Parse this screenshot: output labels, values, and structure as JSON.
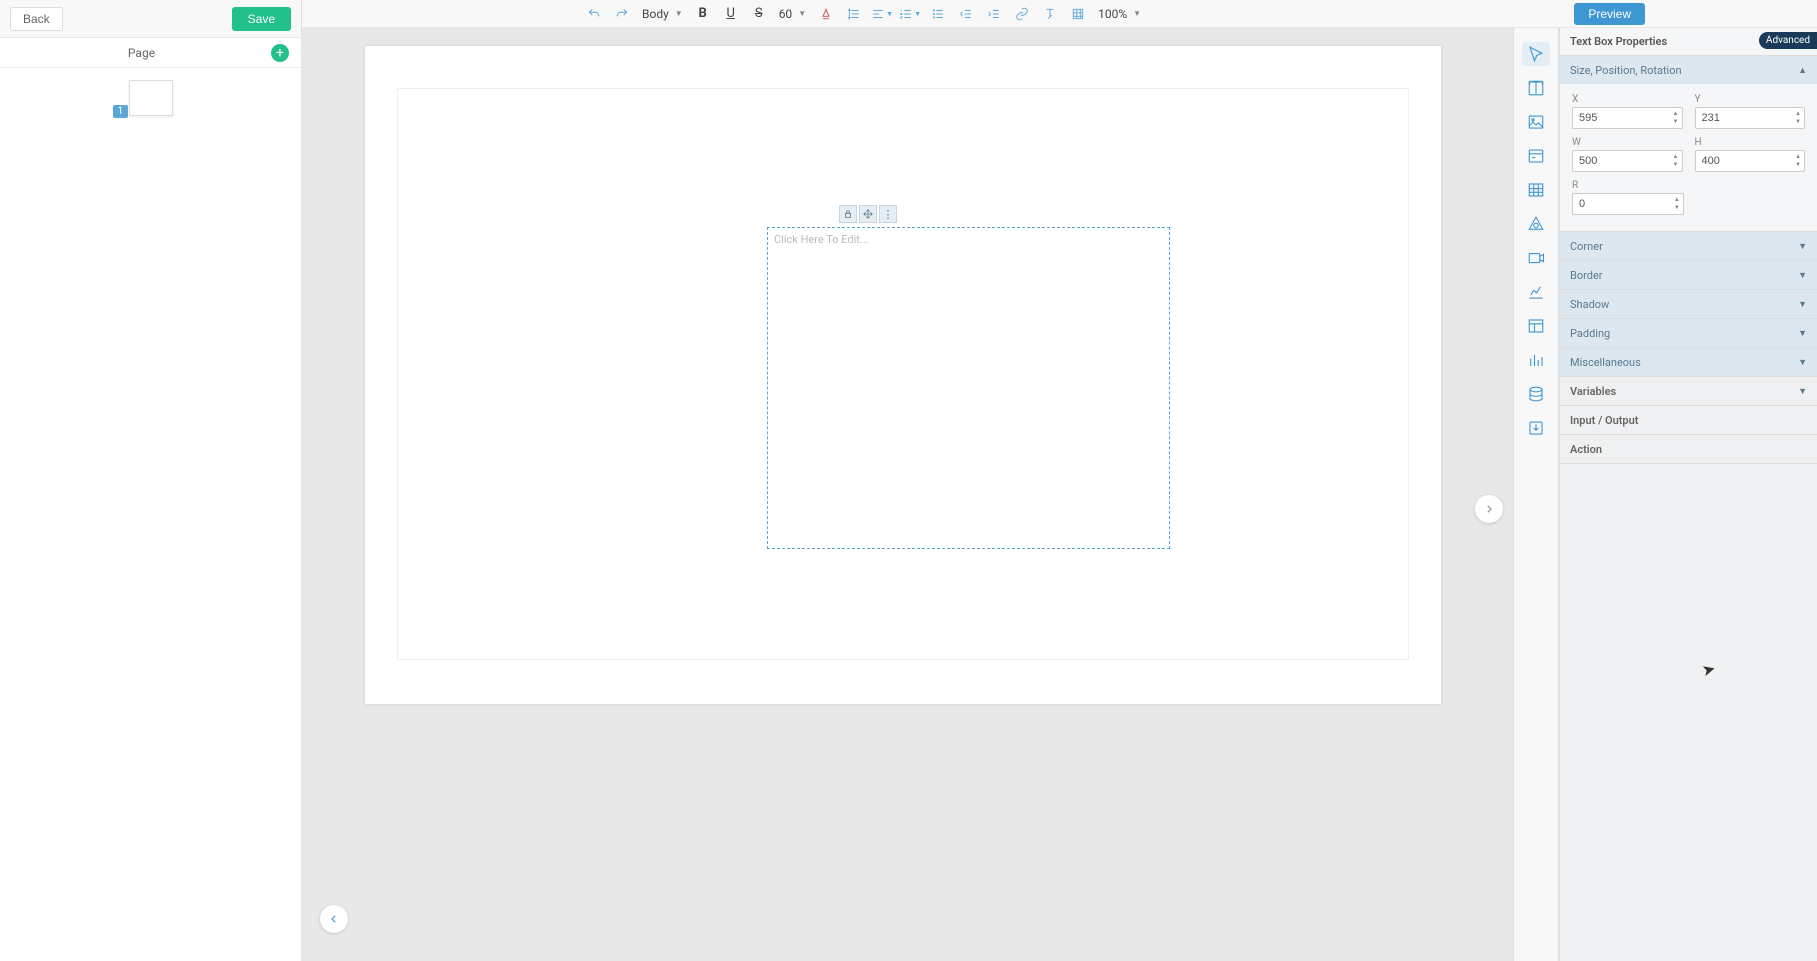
{
  "left": {
    "back": "Back",
    "save": "Save",
    "pages_label": "Page",
    "thumb_badge": "1"
  },
  "toolbar": {
    "style_select": "Body",
    "fontsize": "60",
    "zoom": "100%"
  },
  "preview_btn": "Preview",
  "textbox": {
    "placeholder": "Click Here To Edit..."
  },
  "tool_strip": [
    {
      "name": "pointer-icon"
    },
    {
      "name": "text-icon"
    },
    {
      "name": "image-icon"
    },
    {
      "name": "panel-icon"
    },
    {
      "name": "grid-icon"
    },
    {
      "name": "shape-icon"
    },
    {
      "name": "video-icon"
    },
    {
      "name": "linechart-icon"
    },
    {
      "name": "layout-icon"
    },
    {
      "name": "barchart-icon"
    },
    {
      "name": "data-icon"
    },
    {
      "name": "download-icon"
    }
  ],
  "props": {
    "title": "Text Box Properties",
    "advanced": "Advanced",
    "sections": {
      "size_pos": "Size, Position, Rotation",
      "corner": "Corner",
      "border": "Border",
      "shadow": "Shadow",
      "padding": "Padding",
      "misc": "Miscellaneous",
      "variables": "Variables",
      "io": "Input / Output",
      "action": "Action"
    },
    "fields": {
      "x_label": "X",
      "x_value": "595",
      "y_label": "Y",
      "y_value": "231",
      "w_label": "W",
      "w_value": "500",
      "h_label": "H",
      "h_value": "400",
      "r_label": "R",
      "r_value": "0"
    }
  }
}
